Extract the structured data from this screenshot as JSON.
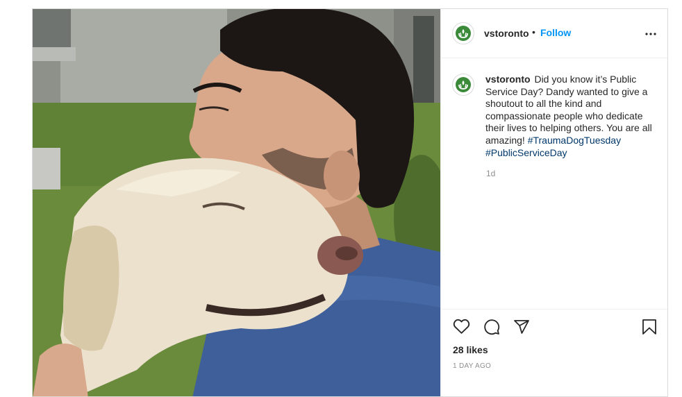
{
  "post": {
    "username": "vstoronto",
    "separator": "•",
    "follow_label": "Follow",
    "more_icon": "more-horizontal-icon",
    "caption": {
      "username": "vstoronto",
      "text": "Did you know it’s Public Service Day? Dandy wanted to give a shoutout to all the kind and compassionate people who dedicate their lives to helping others. You are all amazing!",
      "hashtags": [
        "#TraumaDogTuesday",
        "#PublicServiceDay"
      ],
      "relative_time": "1d"
    },
    "actions": {
      "like_icon": "heart-icon",
      "comment_icon": "comment-bubble-icon",
      "share_icon": "paper-plane-icon",
      "save_icon": "bookmark-icon"
    },
    "likes": "28 likes",
    "posted": "1 DAY AGO"
  },
  "colors": {
    "link_blue": "#0095f6",
    "hashtag": "#00376b",
    "logo_green": "#3a8a3a",
    "muted": "#8e8e8e"
  }
}
